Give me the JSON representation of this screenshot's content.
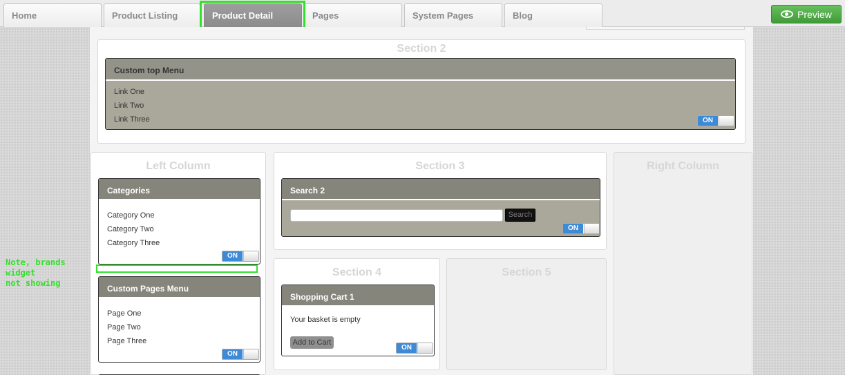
{
  "tabs": [
    {
      "label": "Home",
      "active": false
    },
    {
      "label": "Product Listing",
      "active": false
    },
    {
      "label": "Product Detail",
      "active": true
    },
    {
      "label": "Pages",
      "active": false
    },
    {
      "label": "System Pages",
      "active": false
    },
    {
      "label": "Blog",
      "active": false
    }
  ],
  "preview": {
    "label": "Preview",
    "icon": "eye-icon"
  },
  "section2": {
    "title": "Section 2",
    "widget": {
      "title": "Custom top Menu",
      "links": [
        "Link One",
        "Link Two",
        "Link Three"
      ],
      "toggle": "ON"
    }
  },
  "left_column": {
    "title": "Left Column",
    "categories": {
      "title": "Categories",
      "items": [
        "Category One",
        "Category Two",
        "Category Three"
      ],
      "toggle": "ON"
    },
    "pages_menu": {
      "title": "Custom Pages Menu",
      "items": [
        "Page One",
        "Page Two",
        "Page Three"
      ],
      "toggle": "ON"
    }
  },
  "section3": {
    "title": "Section 3",
    "widget": {
      "title": "Search 2",
      "button": "Search",
      "toggle": "ON"
    }
  },
  "section4": {
    "title": "Section 4",
    "widget": {
      "title": "Shopping Cart 1",
      "message": "Your basket is empty",
      "button": "Add to Cart",
      "toggle": "ON"
    }
  },
  "section5": {
    "title": "Section 5"
  },
  "right_column": {
    "title": "Right Column"
  },
  "note": {
    "line1": "Note, brands widget",
    "line2": "not showing"
  },
  "colors": {
    "highlight": "#33e02c",
    "toggle_on": "#3d8ad6",
    "preview_button": "#4caf45"
  }
}
